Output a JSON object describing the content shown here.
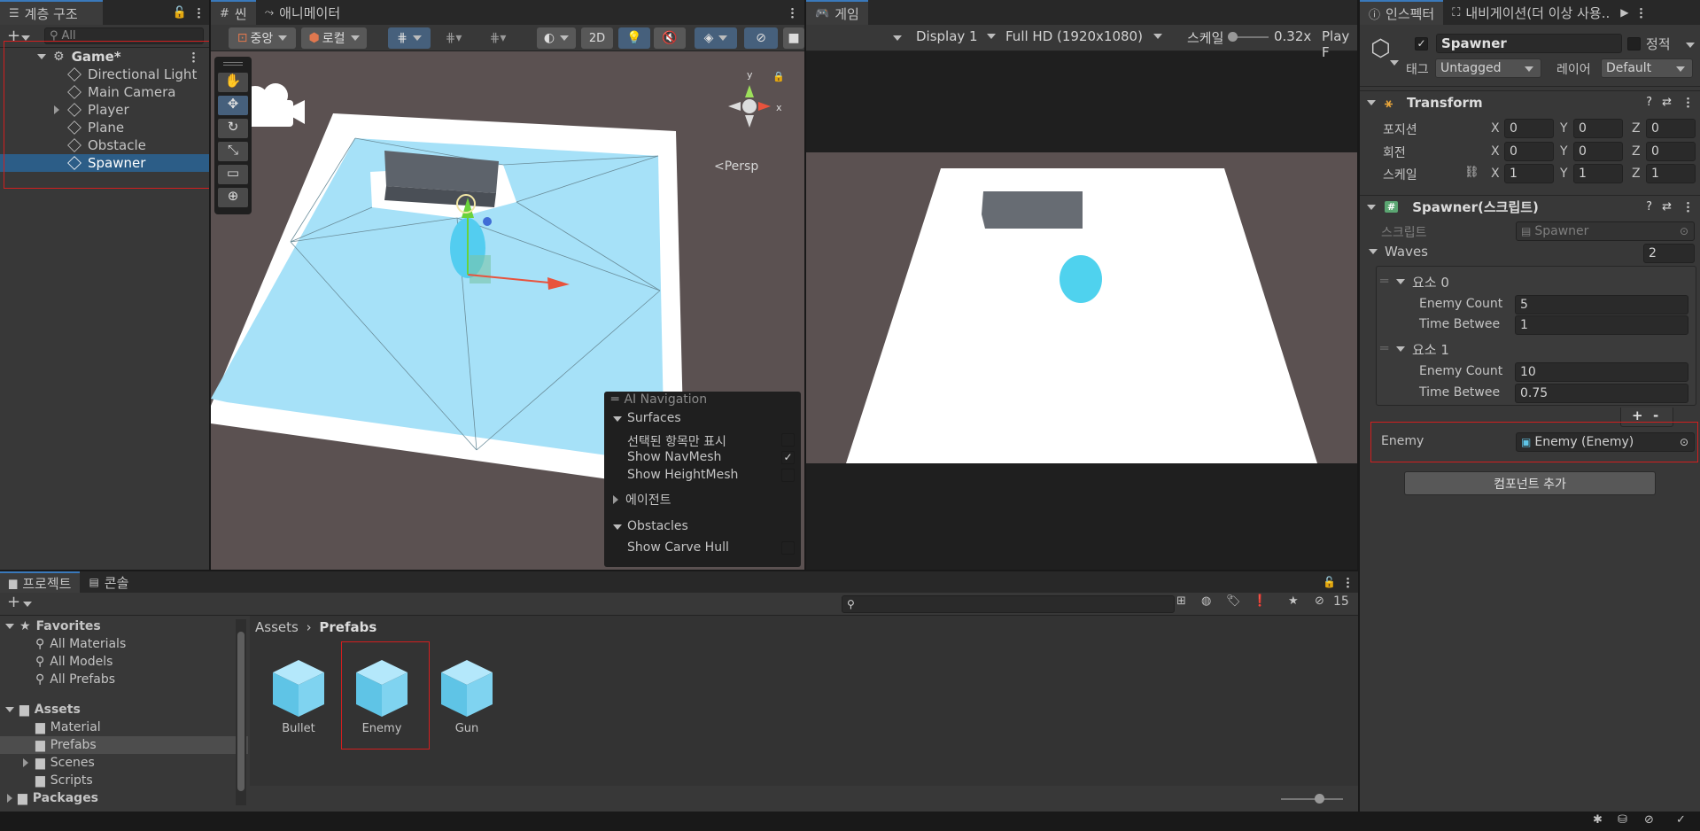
{
  "hierarchy": {
    "tab_label": "계층 구조",
    "search_placeholder": "All",
    "scene_name": "Game*",
    "items": [
      {
        "label": "Directional Light"
      },
      {
        "label": "Main Camera"
      },
      {
        "label": "Player"
      },
      {
        "label": "Plane"
      },
      {
        "label": "Obstacle"
      },
      {
        "label": "Spawner"
      }
    ]
  },
  "scene": {
    "tab_label": "씬",
    "animator_tab_label": "애니메이터",
    "pivot_label": "중앙",
    "space_label": "로컬",
    "mode_2d": "2D",
    "persp_label": "<Persp",
    "gizmo_axis": {
      "x": "x",
      "y": "y"
    },
    "ai_nav": {
      "title": "AI Navigation",
      "surfaces": "Surfaces",
      "show_selected": "선택된 항목만 표시",
      "show_navmesh": "Show NavMesh",
      "show_heightmesh": "Show HeightMesh",
      "agents": "에이전트",
      "obstacles": "Obstacles",
      "show_carve_hull": "Show Carve Hull"
    }
  },
  "game": {
    "tab_label": "게임",
    "display": "Display 1",
    "resolution": "Full HD (1920x1080)",
    "scale_label": "스케일",
    "scale_value": "0.32x",
    "play_label": "Play F"
  },
  "inspector": {
    "tab_label": "인스펙터",
    "nav_tab_label": "내비게이션(더 이상 사용..",
    "object_name": "Spawner",
    "static_label": "정적",
    "tag_label": "태그",
    "tag_value": "Untagged",
    "layer_label": "레이어",
    "layer_value": "Default",
    "transform": {
      "title": "Transform",
      "position_label": "포지션",
      "rotation_label": "회전",
      "scale_label": "스케일",
      "position": [
        "0",
        "0",
        "0"
      ],
      "rotation": [
        "0",
        "0",
        "0"
      ],
      "scale": [
        "1",
        "1",
        "1"
      ],
      "axes": [
        "X",
        "Y",
        "Z"
      ]
    },
    "script_comp": {
      "title": "Spawner(스크립트)",
      "script_label": "스크립트",
      "script_value": "Spawner",
      "waves_label": "Waves",
      "waves_count": "2",
      "elements": [
        {
          "label": "요소 0",
          "enemy_count_label": "Enemy Count",
          "enemy_count": "5",
          "time_label": "Time Betwee",
          "time": "1"
        },
        {
          "label": "요소 1",
          "enemy_count_label": "Enemy Count",
          "enemy_count": "10",
          "time_label": "Time Betwee",
          "time": "0.75"
        }
      ],
      "plus": "+",
      "minus": "-",
      "enemy_label": "Enemy",
      "enemy_value": "Enemy (Enemy)"
    },
    "add_component": "컴포넌트 추가"
  },
  "project": {
    "tab_label": "프로젝트",
    "console_tab_label": "콘솔",
    "hidden_count": "15",
    "favorites": {
      "label": "Favorites",
      "items": [
        "All Materials",
        "All Models",
        "All Prefabs"
      ]
    },
    "assets": {
      "label": "Assets",
      "items": [
        "Material",
        "Prefabs",
        "Scenes",
        "Scripts"
      ]
    },
    "packages": "Packages",
    "breadcrumb": {
      "root": "Assets",
      "current": "Prefabs"
    },
    "prefabs": [
      {
        "label": "Bullet"
      },
      {
        "label": "Enemy"
      },
      {
        "label": "Gun"
      }
    ]
  },
  "colors": {
    "accent": "#3a79bb",
    "selection": "#2c5d87",
    "navmesh": "#a6e1f8",
    "annotation": "#d21f1f"
  }
}
